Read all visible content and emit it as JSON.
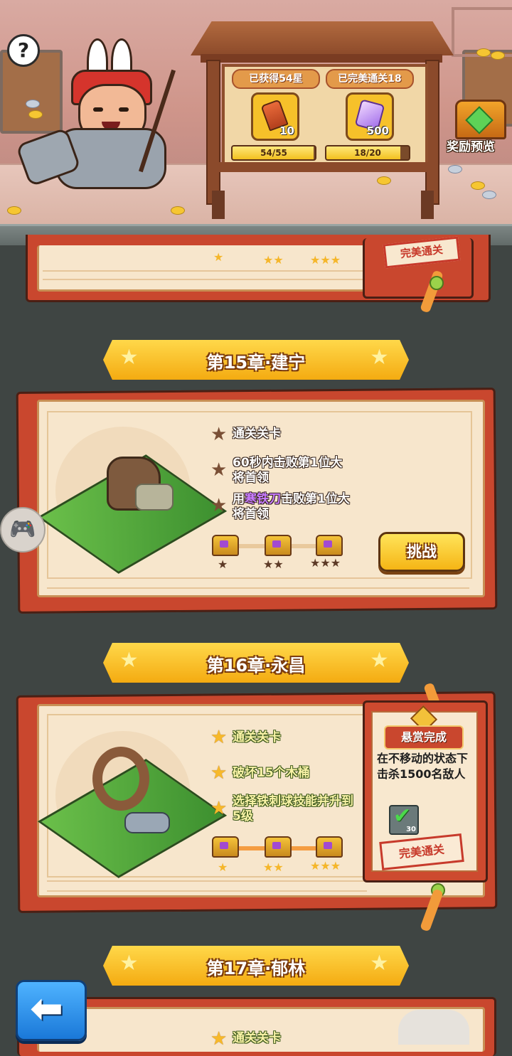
{
  "header": {
    "help_label": "?",
    "stars_label": "已获得54星",
    "perfect_label": "已完美通关18",
    "stars_reward_qty": "10",
    "perfect_reward_qty": "500",
    "stars_progress_text": "54/55",
    "stars_progress_value": 0.98,
    "perfect_progress_text": "18/20",
    "perfect_progress_value": 0.9,
    "reward_preview_label": "奖励预览",
    "icons": {
      "help": "question-icon",
      "stars_reward": "torch-icon",
      "perfect_reward": "crystal-icon",
      "reward_preview": "treasure-chest-icon"
    }
  },
  "chapters": [
    {
      "title": "第15章·建宁",
      "objectives": [
        {
          "text": "通关关卡",
          "done": false
        },
        {
          "text": "60秒内击败第1位大将首领",
          "done": false
        },
        {
          "pre": "用",
          "highlight": "寒铁刀",
          "post": "击败第1位大将首领",
          "done": false
        }
      ],
      "chest_stars": [
        1,
        2,
        3
      ],
      "action_label": "挑战"
    },
    {
      "title": "第16章·永昌",
      "objectives": [
        {
          "text": "通关关卡",
          "done": true
        },
        {
          "text": "破坏15个木桶",
          "done": true
        },
        {
          "text": "选择铁刺球技能并升到5级",
          "done": true
        }
      ],
      "chest_stars": [
        1,
        2,
        3
      ],
      "bounty": {
        "title": "悬赏完成",
        "description": "在不移动的状态下击杀1500名敌人",
        "item_qty": "30",
        "stamp": "完美通关"
      }
    },
    {
      "title": "第17章·郁林",
      "objectives": [
        {
          "text": "通关关卡",
          "done": true
        }
      ]
    }
  ],
  "prev_card": {
    "stamp": "完美通关"
  },
  "colors": {
    "background": "#3f4543",
    "banner": "#f7c124",
    "card_frame": "#c9472e",
    "card_paper": "#f7e6cc",
    "challenge_button": "#f5b515",
    "back_button": "#2a8ce8"
  },
  "icons": {
    "side_button": "gamepad-icon",
    "back_button": "back-arrow-icon"
  }
}
